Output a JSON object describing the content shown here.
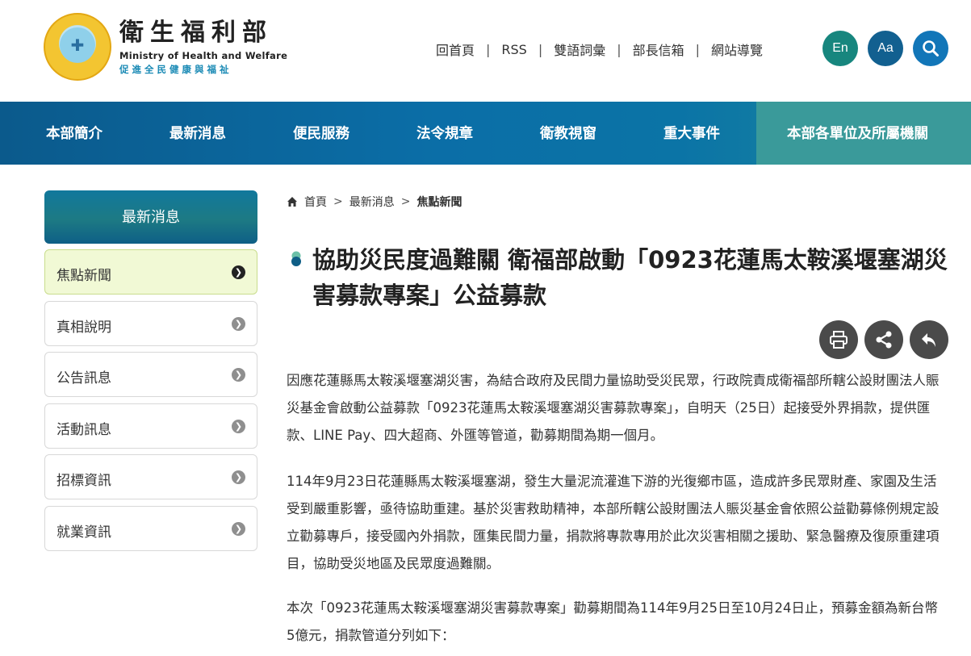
{
  "header": {
    "logo_zh": "衛生福利部",
    "logo_en": "Ministry of Health and Welfare",
    "logo_slogan": "促進全民健康與福祉",
    "top_links": [
      "回首頁",
      "RSS",
      "雙語詞彙",
      "部長信箱",
      "網站導覽"
    ],
    "lang_button": "En",
    "font_button": "Aa"
  },
  "nav": {
    "items": [
      "本部簡介",
      "最新消息",
      "便民服務",
      "法令規章",
      "衛教視窗",
      "重大事件",
      "本部各單位及所屬機關"
    ]
  },
  "sidebar": {
    "heading": "最新消息",
    "items": [
      {
        "label": "焦點新聞",
        "active": true
      },
      {
        "label": "真相說明",
        "active": false
      },
      {
        "label": "公告訊息",
        "active": false
      },
      {
        "label": "活動訊息",
        "active": false
      },
      {
        "label": "招標資訊",
        "active": false
      },
      {
        "label": "就業資訊",
        "active": false
      }
    ]
  },
  "breadcrumb": [
    "首頁",
    "最新消息",
    "焦點新聞"
  ],
  "article": {
    "title": "協助災民度過難關 衛福部啟動「0923花蓮馬太鞍溪堰塞湖災害募款專案」公益募款",
    "paragraphs": [
      "因應花蓮縣馬太鞍溪堰塞湖災害，為結合政府及民間力量協助受災民眾，行政院責成衛福部所轄公設財團法人賑災基金會啟動公益募款「0923花蓮馬太鞍溪堰塞湖災害募款專案」，自明天（25日）起接受外界捐款，提供匯款、LINE Pay、四大超商、外匯等管道，勸募期間為期一個月。",
      "114年9月23日花蓮縣馬太鞍溪堰塞湖，發生大量泥流灌進下游的光復鄉市區，造成許多民眾財產、家園及生活受到嚴重影響，亟待協助重建。基於災害救助精神，本部所轄公設財團法人賑災基金會依照公益勸募條例規定設立勸募專戶，接受國內外捐款，匯集民間力量，捐款將專款專用於此次災害相關之援助、緊急醫療及復原重建項目，協助受災地區及民眾度過難關。",
      "本次「0923花蓮馬太鞍溪堰塞湖災害募款專案」勸募期間為114年9月25日至10月24日止，預募金額為新台幣5億元，捐款管道分列如下："
    ]
  },
  "colors": {
    "nav_start": "#0b5a8c",
    "nav_end": "#1d8a9b",
    "active_side_bg": "#f1f9d5",
    "lang_btn": "#17867e",
    "font_btn": "#126090",
    "search_btn": "#1276b8"
  },
  "icons": [
    "search-icon",
    "print-icon",
    "share-icon",
    "back-icon",
    "home-icon",
    "chevron-right-icon"
  ]
}
